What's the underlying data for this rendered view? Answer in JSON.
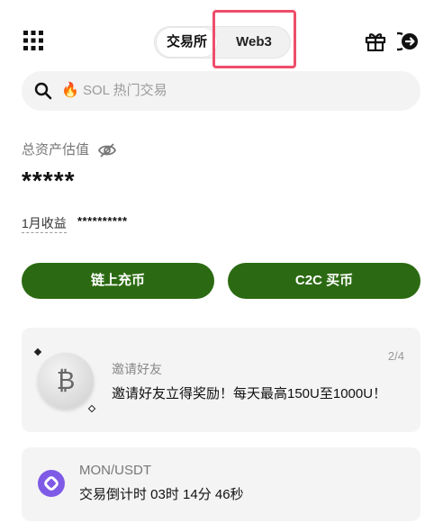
{
  "header": {
    "tabs": [
      {
        "label": "交易所",
        "active": true
      },
      {
        "label": "Web3",
        "active": false
      }
    ],
    "icons": {
      "menu": "grid-menu-icon",
      "gift": "gift-icon",
      "exit": "exit-icon"
    }
  },
  "search": {
    "fire_emoji": "🔥",
    "placeholder": "SOL 热门交易"
  },
  "assets": {
    "label": "总资产估值",
    "value": "*****",
    "monthly_label": "1月收益",
    "monthly_value": "**********"
  },
  "actions": {
    "onchain_deposit": "链上充币",
    "c2c_buy": "C2C 买币"
  },
  "invite_card": {
    "title": "邀请好友",
    "description": "邀请好友立得奖励！每天最高150U至1000U！",
    "page_indicator": "2/4",
    "coin_symbol": "₿"
  },
  "mon_card": {
    "pair": "MON/USDT",
    "countdown": "交易倒计时 03时 14分 46秒"
  },
  "colors": {
    "primary_button": "#2b6a12",
    "highlight": "#ef4d6a",
    "mon_icon": "#7f5ae6"
  }
}
